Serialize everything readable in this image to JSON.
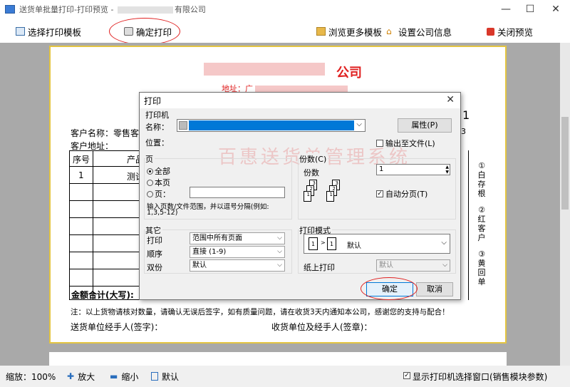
{
  "window": {
    "title_prefix": "送货单批量打印-打印预览 - ",
    "title_suffix": "有限公司",
    "minimize": "—",
    "maximize": "☐",
    "close": "✕"
  },
  "toolbar": {
    "select_template": "选择打印模板",
    "confirm_print": "确定打印",
    "browse_templates": "浏览更多模板",
    "company_info": "设置公司信息",
    "close_preview": "关闭预览"
  },
  "paper": {
    "company_suffix": "公司",
    "address_label": "地址：广",
    "customer_name": "客户名称：零售客",
    "customer_address": "客户地址：",
    "col_seq": "序号",
    "col_product": "产品",
    "row1_seq": "1",
    "row1_product": "测试",
    "total_label": "金额合计(大写):",
    "note": "注：以上货物请核对数量，请确认无误后签字，如有质量问题，请在收货3天内通知本公司，感谢您的支持与配合！",
    "sender_sign": "送货单位经手人(签字)：",
    "receiver_sign": "收货单位及经手人(签章)：",
    "side_1": "①白存根",
    "side_2": "②红客户",
    "side_3": "③黄回单",
    "num_1": "1",
    "num_3": "3"
  },
  "status": {
    "zoom": "缩放：100%",
    "zoom_in": "放大",
    "zoom_out": "缩小",
    "default": "默认",
    "show_printer": "显示打印机选择窗口(销售模块参数)"
  },
  "dialog": {
    "title": "打印",
    "close": "✕",
    "printer_group": "打印机",
    "name_label": "名称：",
    "location_label": "位置：",
    "properties": "属性(P)",
    "print_to_file": "输出至文件(L)",
    "page_group": "页",
    "all": "全部",
    "current": "本页",
    "pages": "页：",
    "range_hint": "输入页数/文件范围，并以逗号分隔(例如:",
    "range_example": "1,3,5-12)",
    "copies_group": "份数(C)",
    "copies_label": "份数",
    "copies_value": "1",
    "collate": "自动分页(T)",
    "other_group": "其它",
    "print_label": "打印",
    "print_value": "范围中所有页面",
    "order_label": "顺序",
    "order_value": "直接 (1-9)",
    "duplex_label": "双份",
    "duplex_value": "默认",
    "mode_group": "打印模式",
    "mode_value": "默认",
    "paper_print_label": "纸上打印",
    "paper_print_value": "默认",
    "ok": "确定",
    "cancel": "取消",
    "watermark": "百惠送货单管理系统"
  },
  "colors": {
    "accent": "#e02020",
    "paper_border": "#e4c542",
    "printer_bar": "#0078d7"
  }
}
